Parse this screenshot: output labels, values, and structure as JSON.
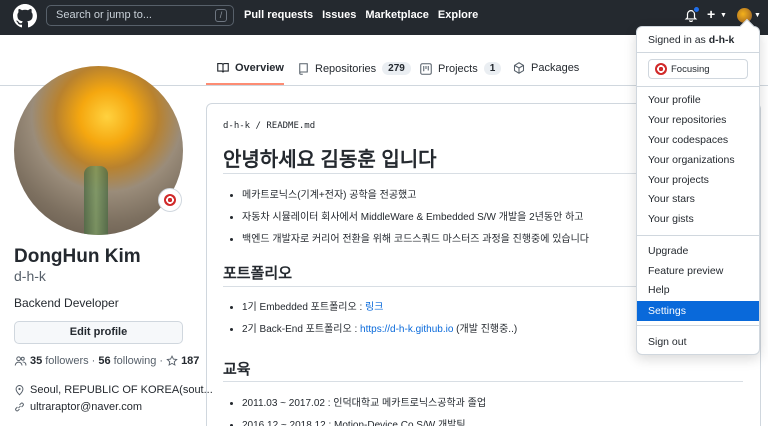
{
  "header": {
    "search_placeholder": "Search or jump to...",
    "slash_key": "/",
    "nav": [
      "Pull requests",
      "Issues",
      "Marketplace",
      "Explore"
    ],
    "plus": "+"
  },
  "tabs": [
    {
      "label": "Overview",
      "count": null,
      "active": true
    },
    {
      "label": "Repositories",
      "count": "279"
    },
    {
      "label": "Projects",
      "count": "1"
    },
    {
      "label": "Packages",
      "count": null
    }
  ],
  "profile": {
    "fullname": "DongHun Kim",
    "login": "d-h-k",
    "bio": "Backend Developer",
    "edit_label": "Edit profile",
    "followers_count": "35",
    "followers_label": "followers",
    "following_count": "56",
    "following_label": "following",
    "stars_count": "187",
    "location": "Seoul, REPUBLIC OF KOREA(sout...",
    "email": "ultraraptor@naver.com"
  },
  "readme": {
    "path_user": "d-h-k",
    "path_sep": "/",
    "path_file": "README.md",
    "title": "안녕하세요 김동훈 입니다",
    "intro": [
      "메카트로닉스(기계+전자) 공학을 전공했고",
      "자동차 시뮬레이터 회사에서 MiddleWare & Embedded S/W 개발을 2년동안 하고",
      "백엔드 개발자로 커리어 전환을 위해 코드스쿼드 마스터즈 과정을 진행중에 있습니다"
    ],
    "portfolio_heading": "포트폴리오",
    "portfolio1_text": "1기 Embedded 포트폴리오 : ",
    "portfolio1_link": "링크",
    "portfolio2_text": "2기 Back-End 포트폴리오 : ",
    "portfolio2_link": "https://d-h-k.github.io",
    "portfolio2_suffix": " (개발 진행중..)",
    "edu_heading": "교육",
    "edu": [
      "2011.03 ~ 2017.02 : 인덕대학교 메카트로닉스공학과 졸업",
      "2016.12 ~ 2018.12 : Motion-Device.Co S/W 개발팀"
    ]
  },
  "dropdown": {
    "signed_prefix": "Signed in as ",
    "signed_user": "d-h-k",
    "status": "Focusing",
    "items1": [
      "Your profile",
      "Your repositories",
      "Your codespaces",
      "Your organizations",
      "Your projects",
      "Your stars",
      "Your gists"
    ],
    "items2": [
      "Upgrade",
      "Feature preview",
      "Help",
      "Settings"
    ],
    "selected": "Settings",
    "signout": "Sign out"
  },
  "colors": {
    "header_bg": "#24292f",
    "accent": "#0969da",
    "tab_underline": "#fd8c73"
  }
}
